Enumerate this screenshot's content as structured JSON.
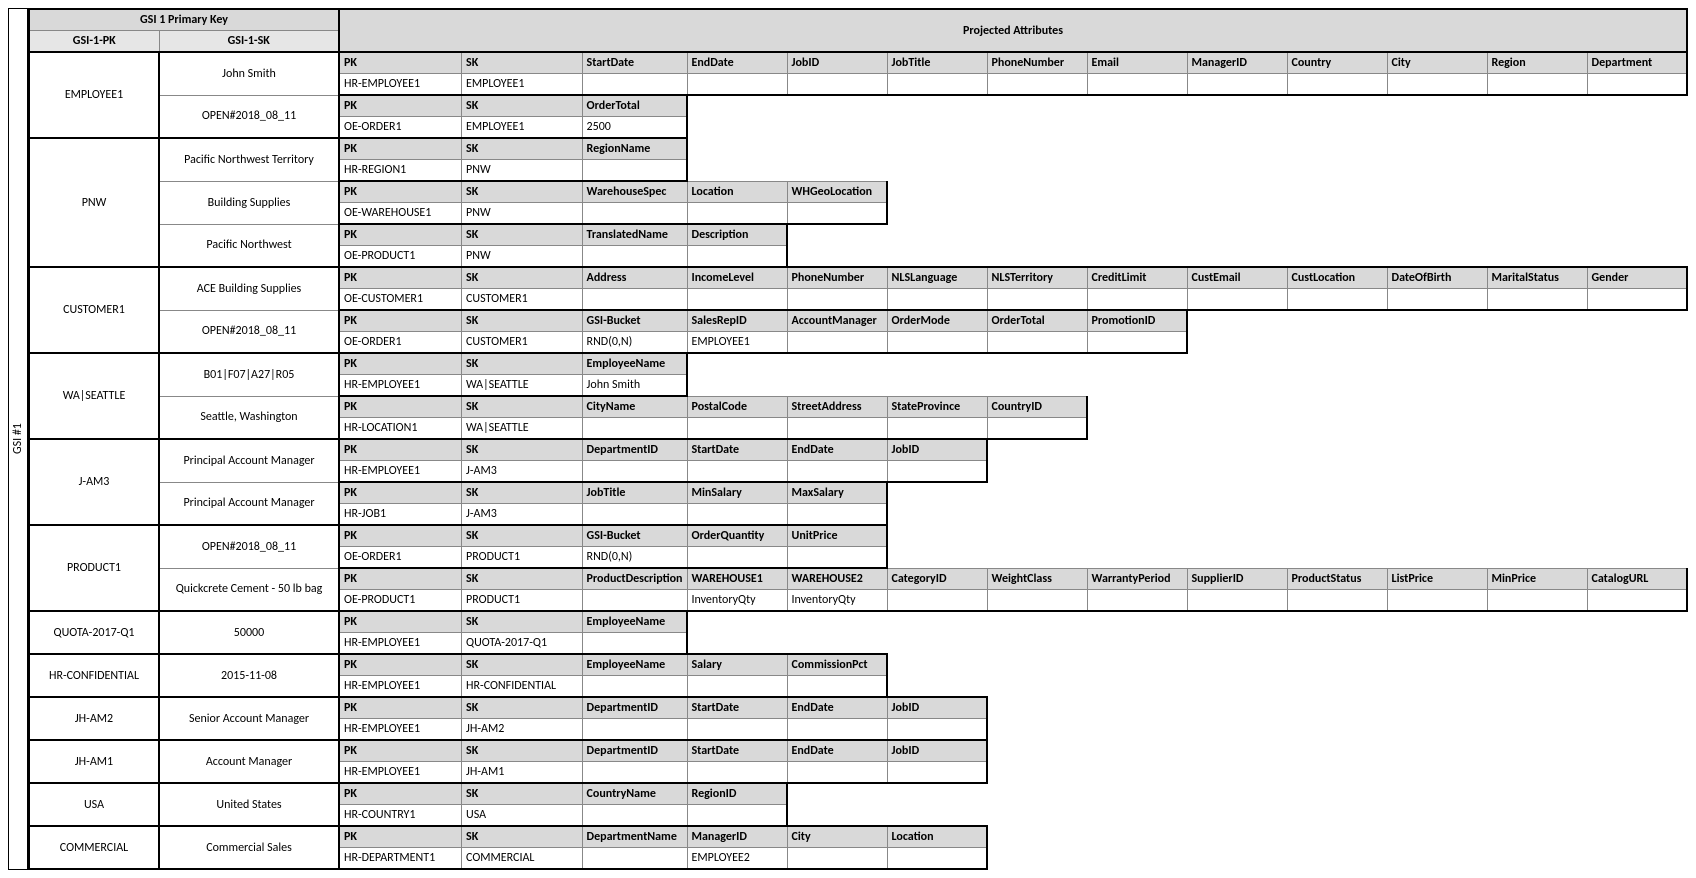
{
  "sidelabel": "GSI #1",
  "header": {
    "top_left": "GSI 1 Primary Key",
    "top_right": "Projected Attributes",
    "pk": "GSI-1-PK",
    "sk": "GSI-1-SK"
  },
  "groups": [
    {
      "pk": "EMPLOYEE1",
      "blocks": [
        {
          "sk": "John Smith",
          "head": [
            "PK",
            "SK",
            "StartDate",
            "EndDate",
            "JobID",
            "JobTitle",
            "PhoneNumber",
            "Email",
            "ManagerID",
            "Country",
            "City",
            "Region",
            "Department"
          ],
          "data": [
            "HR-EMPLOYEE1",
            "EMPLOYEE1",
            "",
            "",
            "",
            "",
            "",
            "",
            "",
            "",
            "",
            "",
            ""
          ]
        },
        {
          "sk": "OPEN#2018_08_11",
          "head": [
            "PK",
            "SK",
            "OrderTotal"
          ],
          "data": [
            "OE-ORDER1",
            "EMPLOYEE1",
            "2500"
          ]
        }
      ]
    },
    {
      "pk": "PNW",
      "blocks": [
        {
          "sk": "Pacific Northwest Territory",
          "head": [
            "PK",
            "SK",
            "RegionName"
          ],
          "data": [
            "HR-REGION1",
            "PNW",
            ""
          ]
        },
        {
          "sk": "Building Supplies",
          "head": [
            "PK",
            "SK",
            "WarehouseSpec",
            "Location",
            "WHGeoLocation"
          ],
          "data": [
            "OE-WAREHOUSE1",
            "PNW",
            "",
            "",
            ""
          ]
        },
        {
          "sk": "Pacific Northwest",
          "head": [
            "PK",
            "SK",
            "TranslatedName",
            "Description"
          ],
          "data": [
            "OE-PRODUCT1",
            "PNW",
            "",
            ""
          ]
        }
      ]
    },
    {
      "pk": "CUSTOMER1",
      "blocks": [
        {
          "sk": "ACE Building Supplies",
          "head": [
            "PK",
            "SK",
            "Address",
            "IncomeLevel",
            "PhoneNumber",
            "NLSLanguage",
            "NLSTerritory",
            "CreditLimit",
            "CustEmail",
            "CustLocation",
            "DateOfBirth",
            "MaritalStatus",
            "Gender"
          ],
          "data": [
            "OE-CUSTOMER1",
            "CUSTOMER1",
            "",
            "",
            "",
            "",
            "",
            "",
            "",
            "",
            "",
            "",
            ""
          ]
        },
        {
          "sk": "OPEN#2018_08_11",
          "head": [
            "PK",
            "SK",
            "GSI-Bucket",
            "SalesRepID",
            "AccountManager",
            "OrderMode",
            "OrderTotal",
            "PromotionID"
          ],
          "data": [
            "OE-ORDER1",
            "CUSTOMER1",
            "RND(0,N)",
            "EMPLOYEE1",
            "",
            "",
            "",
            ""
          ]
        }
      ]
    },
    {
      "pk": "WA|SEATTLE",
      "blocks": [
        {
          "sk": "B01|F07|A27|R05",
          "head": [
            "PK",
            "SK",
            "EmployeeName"
          ],
          "data": [
            "HR-EMPLOYEE1",
            "WA|SEATTLE",
            "John Smith"
          ]
        },
        {
          "sk": "Seattle, Washington",
          "head": [
            "PK",
            "SK",
            "CityName",
            "PostalCode",
            "StreetAddress",
            "StateProvince",
            "CountryID"
          ],
          "data": [
            "HR-LOCATION1",
            "WA|SEATTLE",
            "",
            "",
            "",
            "",
            ""
          ]
        }
      ]
    },
    {
      "pk": "J-AM3",
      "blocks": [
        {
          "sk": "Principal Account Manager",
          "head": [
            "PK",
            "SK",
            "DepartmentID",
            "StartDate",
            "EndDate",
            "JobID"
          ],
          "data": [
            "HR-EMPLOYEE1",
            "J-AM3",
            "",
            "",
            "",
            ""
          ]
        },
        {
          "sk": "Principal Account Manager",
          "head": [
            "PK",
            "SK",
            "JobTitle",
            "MinSalary",
            "MaxSalary"
          ],
          "data": [
            "HR-JOB1",
            "J-AM3",
            "",
            "",
            ""
          ]
        }
      ]
    },
    {
      "pk": "PRODUCT1",
      "blocks": [
        {
          "sk": "OPEN#2018_08_11",
          "head": [
            "PK",
            "SK",
            "GSI-Bucket",
            "OrderQuantity",
            "UnitPrice"
          ],
          "data": [
            "OE-ORDER1",
            "PRODUCT1",
            "RND(0,N)",
            "",
            ""
          ]
        },
        {
          "sk": "Quickcrete Cement - 50 lb bag",
          "head": [
            "PK",
            "SK",
            "ProductDescription",
            "WAREHOUSE1",
            "WAREHOUSE2",
            "CategoryID",
            "WeightClass",
            "WarrantyPeriod",
            "SupplierID",
            "ProductStatus",
            "ListPrice",
            "MinPrice",
            "CatalogURL"
          ],
          "data": [
            "OE-PRODUCT1",
            "PRODUCT1",
            "",
            "InventoryQty",
            "InventoryQty",
            "",
            "",
            "",
            "",
            "",
            "",
            "",
            ""
          ]
        }
      ]
    },
    {
      "pk": "QUOTA-2017-Q1",
      "blocks": [
        {
          "sk": "50000",
          "head": [
            "PK",
            "SK",
            "EmployeeName"
          ],
          "data": [
            "HR-EMPLOYEE1",
            "QUOTA-2017-Q1",
            ""
          ]
        }
      ]
    },
    {
      "pk": "HR-CONFIDENTIAL",
      "blocks": [
        {
          "sk": "2015-11-08",
          "head": [
            "PK",
            "SK",
            "EmployeeName",
            "Salary",
            "CommissionPct"
          ],
          "data": [
            "HR-EMPLOYEE1",
            "HR-CONFIDENTIAL",
            "",
            "",
            ""
          ]
        }
      ]
    },
    {
      "pk": "JH-AM2",
      "blocks": [
        {
          "sk": "Senior Account Manager",
          "head": [
            "PK",
            "SK",
            "DepartmentID",
            "StartDate",
            "EndDate",
            "JobID"
          ],
          "data": [
            "HR-EMPLOYEE1",
            "JH-AM2",
            "",
            "",
            "",
            ""
          ]
        }
      ]
    },
    {
      "pk": "JH-AM1",
      "blocks": [
        {
          "sk": "Account Manager",
          "head": [
            "PK",
            "SK",
            "DepartmentID",
            "StartDate",
            "EndDate",
            "JobID"
          ],
          "data": [
            "HR-EMPLOYEE1",
            "JH-AM1",
            "",
            "",
            "",
            ""
          ]
        }
      ]
    },
    {
      "pk": "USA",
      "blocks": [
        {
          "sk": "United States",
          "head": [
            "PK",
            "SK",
            "CountryName",
            "RegionID"
          ],
          "data": [
            "HR-COUNTRY1",
            "USA",
            "",
            ""
          ]
        }
      ]
    },
    {
      "pk": "COMMERCIAL",
      "blocks": [
        {
          "sk": "Commercial Sales",
          "head": [
            "PK",
            "SK",
            "DepartmentName",
            "ManagerID",
            "City",
            "Location"
          ],
          "data": [
            "HR-DEPARTMENT1",
            "COMMERCIAL",
            "",
            "EMPLOYEE2",
            "",
            ""
          ]
        }
      ]
    }
  ]
}
